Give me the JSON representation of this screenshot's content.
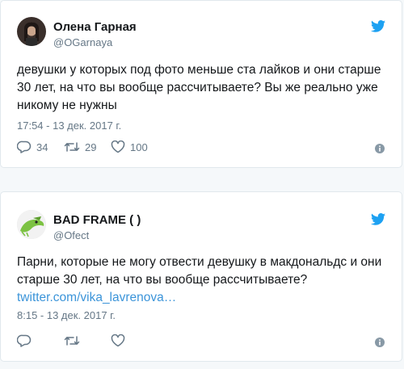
{
  "tweets": [
    {
      "name": "Олена Гарная",
      "handle": "@OGarnaya",
      "text": "девушки у которых под фото меньше ста лайков и они старше 30 лет, на что вы вообще рассчитываете? Вы же реально уже никому не нужны",
      "link": "",
      "time": "17:54 - 13 дек. 2017 г.",
      "replies": "34",
      "retweets": "29",
      "likes": "100"
    },
    {
      "name": "BAD FRAME ( )",
      "handle": "@Ofect",
      "text": "Парни, которые не могу отвести девушку в макдональдс и они старше 30 лет, на что вы вообще рассчитываете?",
      "link": "twitter.com/vika_lavrenova…",
      "time": "8:15 - 13 дек. 2017 г.",
      "replies": "",
      "retweets": "",
      "likes": ""
    }
  ],
  "colors": {
    "twitter_blue": "#1da1f2",
    "link": "#3b94d9",
    "secondary_text": "#657786",
    "primary_text": "#14171a"
  },
  "icons": [
    "twitter-bird-icon",
    "reply-icon",
    "retweet-icon",
    "like-icon",
    "info-icon"
  ]
}
